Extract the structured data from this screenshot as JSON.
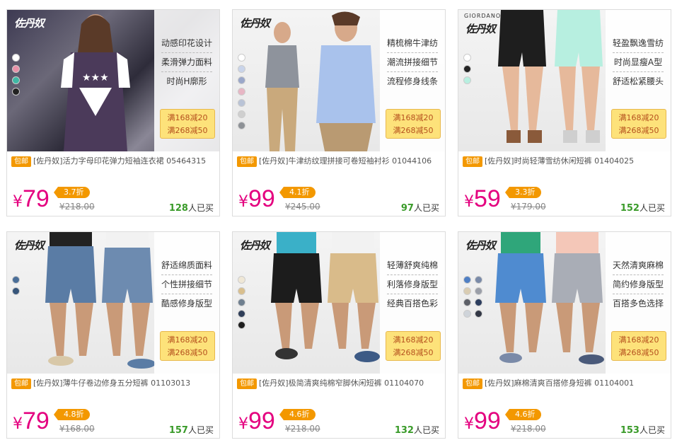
{
  "products": [
    {
      "features": [
        "动感印花设计",
        "柔滑弹力面料",
        "时尚H廓形"
      ],
      "promo": [
        "满168减20",
        "满268减50"
      ],
      "free_tag": "包邮",
      "title": "[佐丹奴]活力字母印花弹力短袖连衣裙 05464315",
      "currency": "¥",
      "price": "79",
      "discount": "3.7折",
      "original": "¥218.00",
      "sold_count": "128",
      "sold_suffix": "人已买",
      "swatch_colors": [
        "#ffffff",
        "#e891a8",
        "#3fb8a5",
        "#222222"
      ]
    },
    {
      "features": [
        "精梳棉牛津纺",
        "潮流拼接细节",
        "流程修身线条"
      ],
      "promo": [
        "满168减20",
        "满268减50"
      ],
      "free_tag": "包邮",
      "title": "[佐丹奴]牛津纺纹理拼接可卷短袖衬衫 01044106",
      "currency": "¥",
      "price": "99",
      "discount": "4.1折",
      "original": "¥245.00",
      "sold_count": "97",
      "sold_suffix": "人已买",
      "swatch_colors": [
        "#ffffff",
        "#c9d4ea",
        "#9aa7c9",
        "#e7b6c4",
        "#b9c3d6",
        "#cfcfcf",
        "#8d9196"
      ]
    },
    {
      "features": [
        "轻盈飘逸雪纺",
        "时尚显瘦A型",
        "舒适松紧腰头"
      ],
      "promo": [
        "满168减20",
        "满268减50"
      ],
      "free_tag": "包邮",
      "title": "[佐丹奴]时尚轻薄雪纺休闲短裤 01404025",
      "currency": "¥",
      "price": "59",
      "discount": "3.3折",
      "original": "¥179.00",
      "sold_count": "152",
      "sold_suffix": "人已买",
      "swatch_colors": [
        "#ffffff",
        "#222222",
        "#b7efe0"
      ]
    },
    {
      "features": [
        "舒适绵质面料",
        "个性拼接细节",
        "酷感修身版型"
      ],
      "promo": [
        "满168减20",
        "满268减50"
      ],
      "free_tag": "包邮",
      "title": "[佐丹奴]薄牛仔卷边修身五分短裤 01103013",
      "currency": "¥",
      "price": "79",
      "discount": "4.8折",
      "original": "¥168.00",
      "sold_count": "157",
      "sold_suffix": "人已买",
      "swatch_colors": [
        "#4a6e98",
        "#36557a"
      ]
    },
    {
      "features": [
        "轻薄舒爽纯棉",
        "利落修身版型",
        "经典百搭色彩"
      ],
      "promo": [
        "满168减20",
        "满268减50"
      ],
      "free_tag": "包邮",
      "title": "[佐丹奴]极简清爽纯棉窄脚休闲短裤 01104070",
      "currency": "¥",
      "price": "99",
      "discount": "4.6折",
      "original": "¥218.00",
      "sold_count": "132",
      "sold_suffix": "人已买",
      "swatch_colors": [
        "#efe7d6",
        "#d9bf8e",
        "#6f7f8f",
        "#2f3e58",
        "#1e1e1e"
      ]
    },
    {
      "features": [
        "天然清爽麻棉",
        "简约修身版型",
        "百搭多色选择"
      ],
      "promo": [
        "满168减20",
        "满268减50"
      ],
      "free_tag": "包邮",
      "title": "[佐丹奴]麻棉清爽百搭修身短裤 01104001",
      "currency": "¥",
      "price": "99",
      "discount": "4.6折",
      "original": "¥218.00",
      "sold_count": "153",
      "sold_suffix": "人已买",
      "swatch_colors": [
        "#4f7fc4",
        "#7a8aa8",
        "#d9ccb2",
        "#9a9ea8",
        "#5d6068",
        "#2c3d5e",
        "#cfd4da",
        "#333845"
      ]
    }
  ],
  "colors": {
    "price": "#e4007f",
    "tag": "#f39800",
    "sold": "#3a9b2a",
    "promo_bg": "#fde27a"
  }
}
